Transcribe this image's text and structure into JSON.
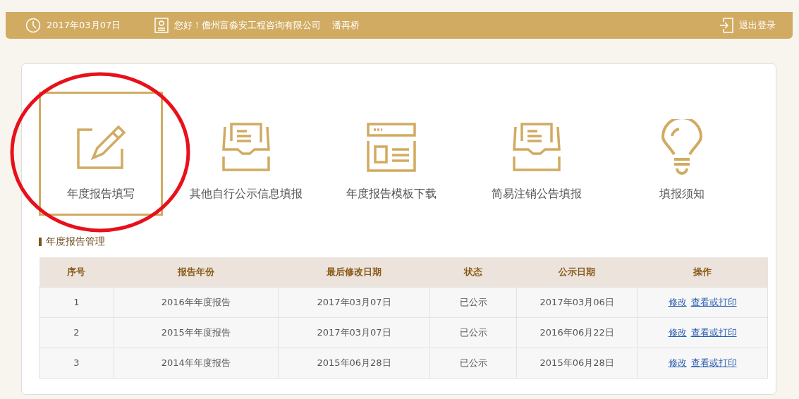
{
  "header": {
    "date": "2017年03月07日",
    "greeting": "您好！儋州富淼安工程咨询有限公司",
    "user": "潘再桥",
    "logout": "退出登录"
  },
  "tiles": [
    {
      "label": "年度报告填写",
      "kind": "pencil",
      "selected": true,
      "circled": true
    },
    {
      "label": "其他自行公示信息填报",
      "kind": "inbox",
      "selected": false,
      "circled": false
    },
    {
      "label": "年度报告模板下载",
      "kind": "template",
      "selected": false,
      "circled": false
    },
    {
      "label": "简易注销公告填报",
      "kind": "inbox",
      "selected": false,
      "circled": false
    },
    {
      "label": "填报须知",
      "kind": "bulb",
      "selected": false,
      "circled": false
    }
  ],
  "section_title": "年度报告管理",
  "table": {
    "columns": [
      "序号",
      "报告年份",
      "最后修改日期",
      "状态",
      "公示日期",
      "操作"
    ],
    "rows": [
      {
        "cells": [
          "1",
          "2016年年度报告",
          "2017年03月07日",
          "已公示",
          "2017年03月06日"
        ],
        "actions": [
          "修改",
          "查看或打印"
        ]
      },
      {
        "cells": [
          "2",
          "2015年年度报告",
          "2017年03月07日",
          "已公示",
          "2016年06月22日"
        ],
        "actions": [
          "修改",
          "查看或打印"
        ]
      },
      {
        "cells": [
          "3",
          "2014年年度报告",
          "2015年06月28日",
          "已公示",
          "2015年06月28日"
        ],
        "actions": [
          "修改",
          "查看或打印"
        ]
      }
    ]
  }
}
